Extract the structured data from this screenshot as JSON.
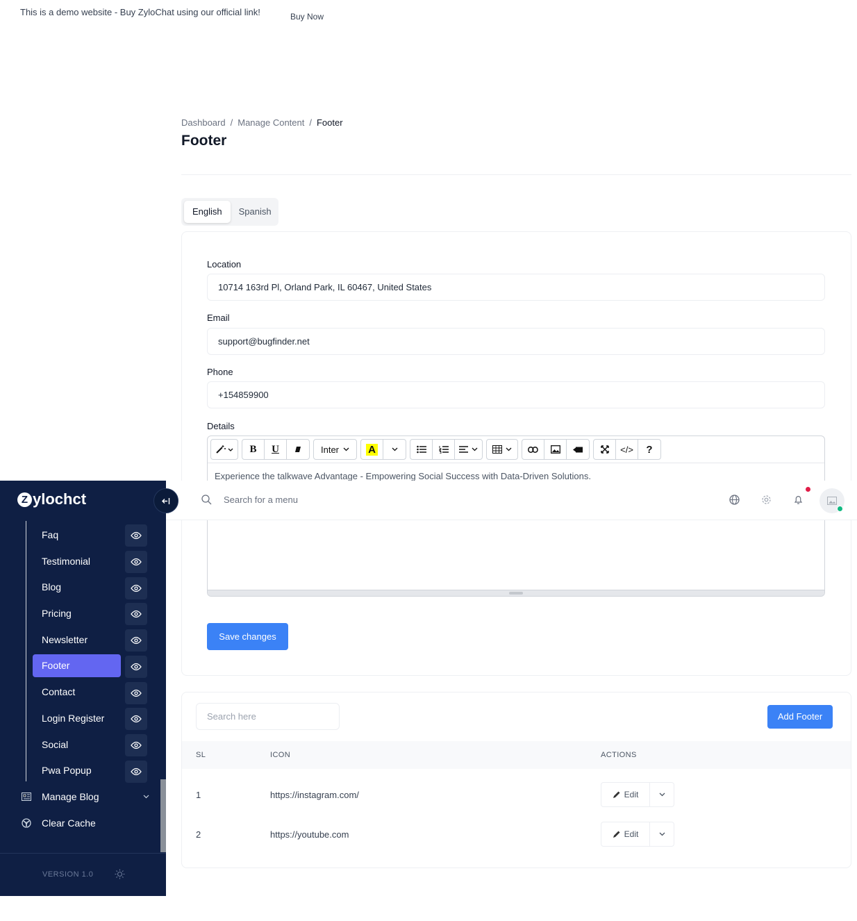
{
  "banner": {
    "text": "This is a demo website - Buy ZyloChat using our official link!",
    "buy_now": "Buy Now"
  },
  "breadcrumb": [
    "Dashboard",
    "Manage Content",
    "Footer"
  ],
  "breadcrumb_separator": "/",
  "page_title": "Footer",
  "language_tabs": [
    {
      "label": "English",
      "active": true
    },
    {
      "label": "Spanish",
      "active": false
    }
  ],
  "form": {
    "location_label": "Location",
    "location_value": "10714 163rd Pl, Orland Park, IL 60467, United States",
    "email_label": "Email",
    "email_value": "support@bugfinder.net",
    "phone_label": "Phone",
    "phone_value": "+154859900",
    "details_label": "Details",
    "details_text": "Experience the talkwave Advantage - Empowering Social Success with Data-Driven Solutions.",
    "save_label": "Save changes"
  },
  "editor_toolbar": {
    "bold": "B",
    "underline": "U",
    "font_name": "Inter",
    "color_letter": "A",
    "code": "</>",
    "help": "?"
  },
  "table": {
    "search_placeholder": "Search here",
    "add_label": "Add Footer",
    "columns": [
      "SL",
      "ICON",
      "ACTIONS"
    ],
    "rows": [
      {
        "sl": "1",
        "icon": "https://instagram.com/",
        "action": "Edit"
      },
      {
        "sl": "2",
        "icon": "https://youtube.com",
        "action": "Edit"
      }
    ]
  },
  "topbar": {
    "search_placeholder": "Search for a menu"
  },
  "sidebar": {
    "logo_mark": "Z",
    "logo_text": "ylochct",
    "items": [
      {
        "label": "Faq",
        "active": false
      },
      {
        "label": "Testimonial",
        "active": false
      },
      {
        "label": "Blog",
        "active": false
      },
      {
        "label": "Pricing",
        "active": false
      },
      {
        "label": "Newsletter",
        "active": false
      },
      {
        "label": "Footer",
        "active": true
      },
      {
        "label": "Contact",
        "active": false
      },
      {
        "label": "Login Register",
        "active": false
      },
      {
        "label": "Social",
        "active": false
      },
      {
        "label": "Pwa Popup",
        "active": false
      }
    ],
    "groups": [
      {
        "label": "Manage Blog",
        "icon": "blog-icon"
      },
      {
        "label": "Clear Cache",
        "icon": "cache-icon"
      }
    ],
    "version": "VERSION 1.0"
  },
  "colors": {
    "primary": "#3b82f6",
    "sidebar_bg": "#0f1f44",
    "sidebar_active": "#6366f1",
    "notification": "#e11d48",
    "online": "#10b981"
  }
}
